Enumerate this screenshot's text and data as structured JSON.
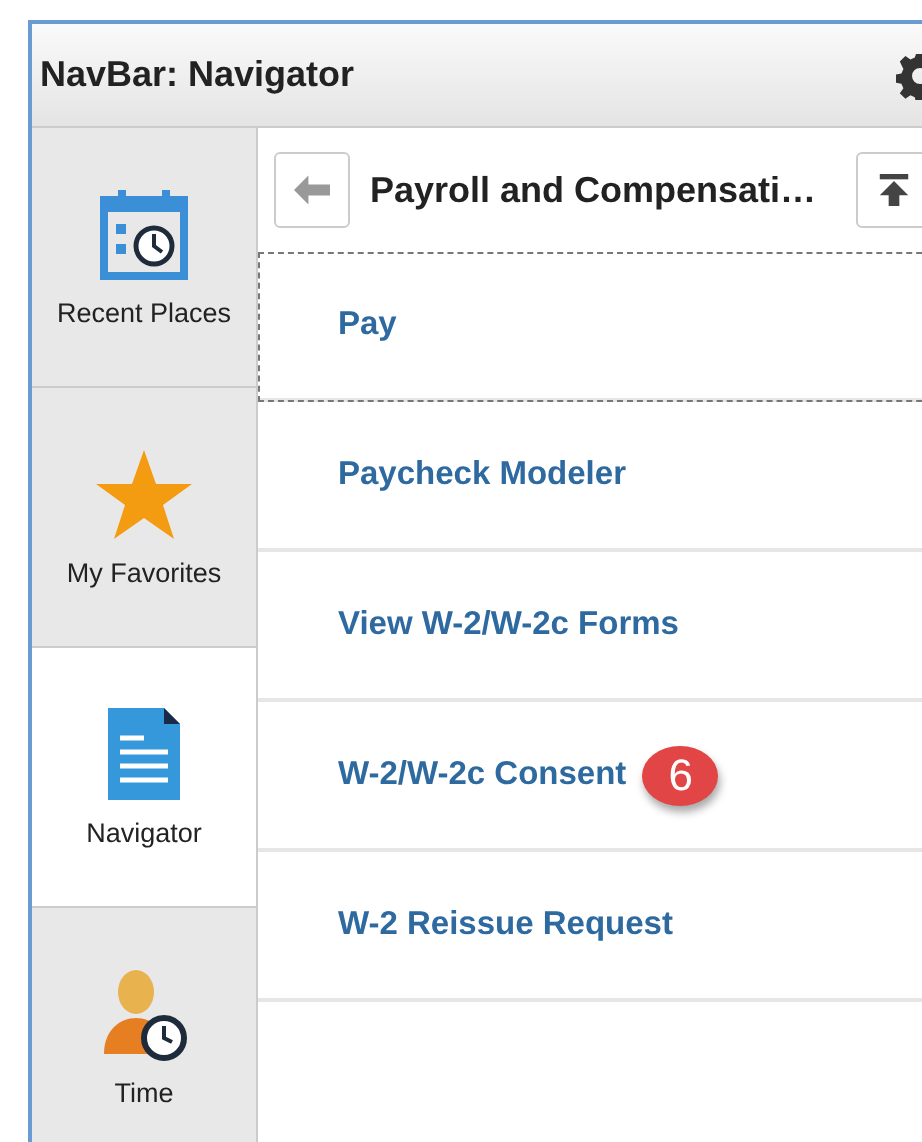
{
  "window": {
    "title": "NavBar: Navigator"
  },
  "navbar": {
    "tiles": [
      {
        "label": "Recent Places",
        "kind": "calendar",
        "selected": false
      },
      {
        "label": "My Favorites",
        "kind": "star",
        "selected": false
      },
      {
        "label": "Navigator",
        "kind": "document",
        "selected": true
      },
      {
        "label": "Time",
        "kind": "person",
        "selected": false
      }
    ]
  },
  "content": {
    "header": {
      "title": "Payroll and Compensati…"
    },
    "items": [
      {
        "label": "Pay",
        "focused": true
      },
      {
        "label": "Paycheck Modeler",
        "focused": false
      },
      {
        "label": "View W-2/W-2c Forms",
        "focused": false
      },
      {
        "label": "W-2/W-2c Consent",
        "focused": false,
        "badge": "6"
      },
      {
        "label": "W-2 Reissue Request",
        "focused": false
      }
    ]
  }
}
